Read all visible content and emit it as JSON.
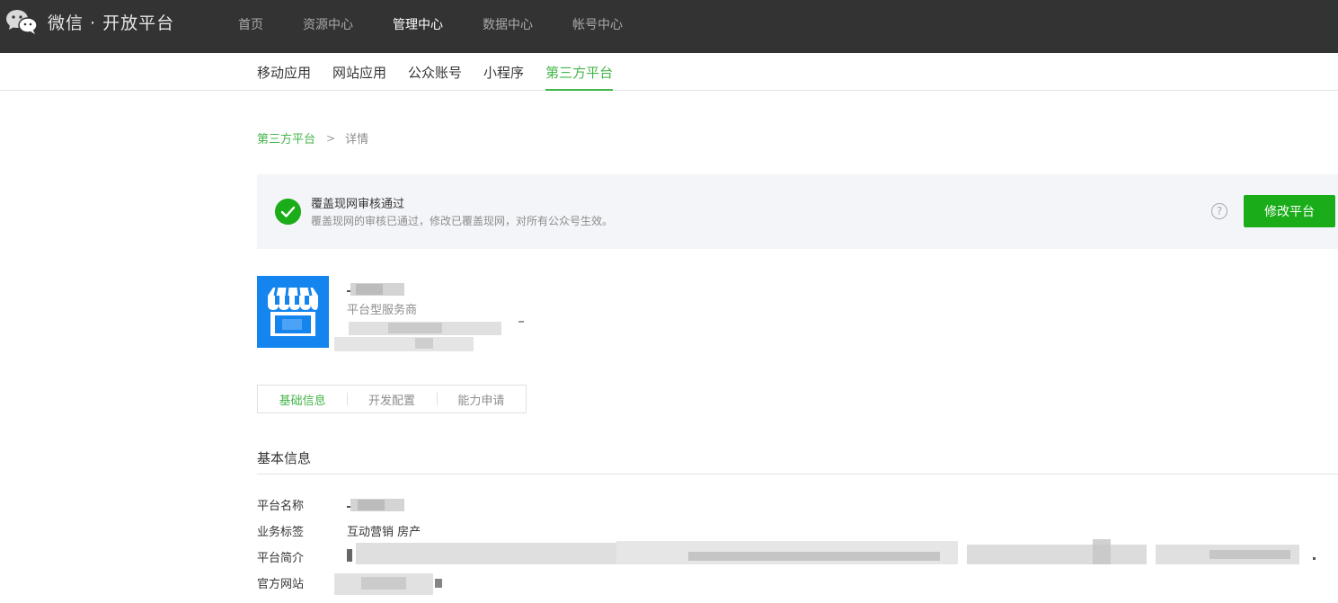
{
  "header": {
    "brand": "微信 · 开放平台",
    "logo_icon": "wechat-logo-icon",
    "nav": [
      {
        "label": "首页",
        "active": false
      },
      {
        "label": "资源中心",
        "active": false
      },
      {
        "label": "管理中心",
        "active": true
      },
      {
        "label": "数据中心",
        "active": false
      },
      {
        "label": "帐号中心",
        "active": false
      }
    ]
  },
  "subnav": {
    "tabs": [
      {
        "label": "移动应用",
        "active": false
      },
      {
        "label": "网站应用",
        "active": false
      },
      {
        "label": "公众账号",
        "active": false
      },
      {
        "label": "小程序",
        "active": false
      },
      {
        "label": "第三方平台",
        "active": true
      }
    ]
  },
  "breadcrumb": {
    "parent": "第三方平台",
    "separator": ">",
    "current": "详情"
  },
  "notice": {
    "title": "覆盖现网审核通过",
    "description": "覆盖现网的审核已通过，修改已覆盖现网，对所有公众号生效。",
    "help_icon": "question-circle-icon",
    "button_label": "修改平台",
    "accent_color": "#1aad19"
  },
  "platform": {
    "type": "平台型服务商",
    "avatar_color": "#1485ee",
    "avatar_icon": "store-awning-icon"
  },
  "detail_tabs": [
    {
      "label": "基础信息",
      "active": true
    },
    {
      "label": "开发配置",
      "active": false
    },
    {
      "label": "能力申请",
      "active": false
    }
  ],
  "basic_info": {
    "section_title": "基本信息",
    "rows": [
      {
        "label": "平台名称",
        "value": ""
      },
      {
        "label": "业务标签",
        "value": "互动营销 房产"
      },
      {
        "label": "平台简介",
        "value": ""
      },
      {
        "label": "官方网站",
        "value": ""
      }
    ]
  },
  "colors": {
    "topbar": "#333333",
    "accent_green": "#44b549",
    "primary_button": "#1aad19"
  }
}
